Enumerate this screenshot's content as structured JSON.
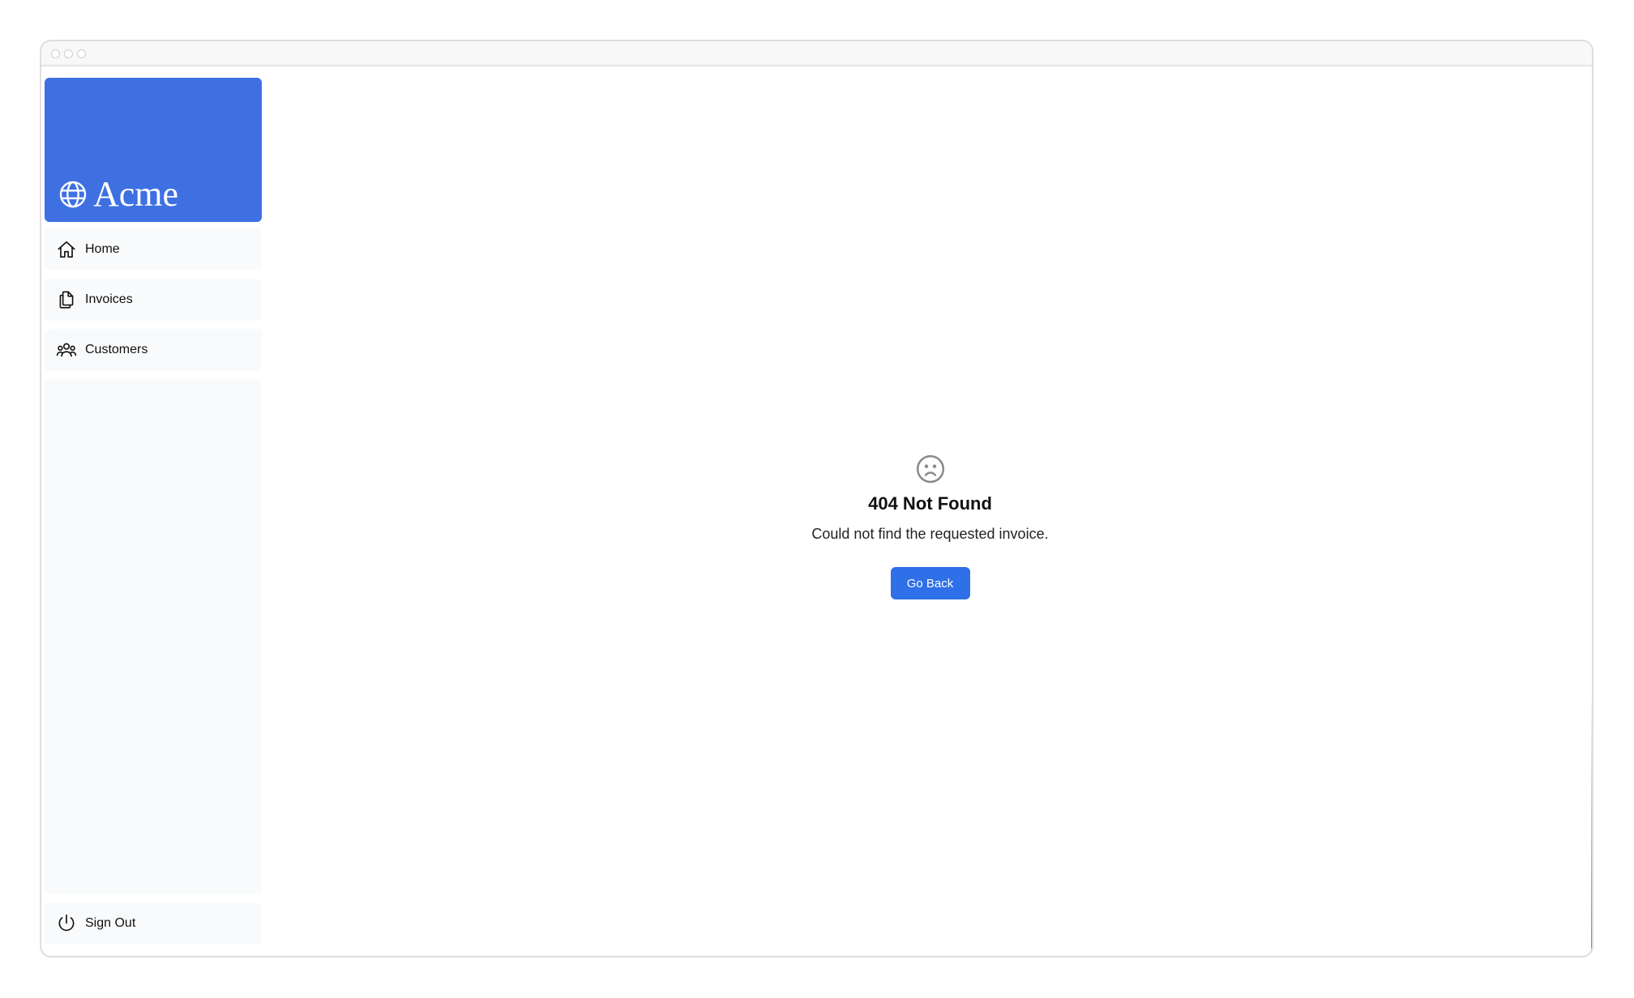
{
  "brand": {
    "name": "Acme",
    "icon": "globe-icon",
    "color": "#3e70e2"
  },
  "sidebar": {
    "items": [
      {
        "label": "Home",
        "icon": "home-icon"
      },
      {
        "label": "Invoices",
        "icon": "documents-icon"
      },
      {
        "label": "Customers",
        "icon": "users-icon"
      }
    ],
    "sign_out": {
      "label": "Sign Out",
      "icon": "power-icon"
    }
  },
  "main": {
    "icon": "sad-face-icon",
    "title": "404 Not Found",
    "message": "Could not find the requested invoice.",
    "button_label": "Go Back",
    "button_color": "#2f6fe8"
  }
}
